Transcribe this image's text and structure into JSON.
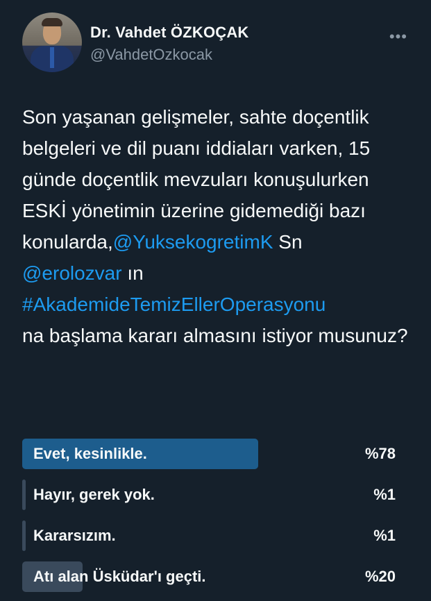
{
  "author": {
    "name": "Dr. Vahdet ÖZKOÇAK",
    "handle": "@VahdetOzkocak"
  },
  "tweet": {
    "text_1": "Son yaşanan gelişmeler, sahte doçentlik belgeleri ve dil puanı iddiaları varken, 15 günde doçentlik mevzuları konuşulurken ESKİ yönetimin üzerine gidemediği bazı konularda,",
    "mention_1": "@YuksekogretimK",
    "text_2": " Sn ",
    "mention_2": "@erolozvar",
    "text_3": " ın ",
    "hashtag": "#AkademideTemizEllerOperasyonu",
    "text_4": " na başlama kararı almasını istiyor musunuz?"
  },
  "poll": {
    "options": [
      {
        "label": "Evet, kesinlikle.",
        "percent_text": "%78",
        "percent": 78,
        "winner": true
      },
      {
        "label": "Hayır, gerek yok.",
        "percent_text": "%1",
        "percent": 1,
        "winner": false
      },
      {
        "label": "Kararsızım.",
        "percent_text": "%1",
        "percent": 1,
        "winner": false
      },
      {
        "label": "Atı alan Üsküdar'ı geçti.",
        "percent_text": "%20",
        "percent": 20,
        "winner": false
      }
    ]
  },
  "icons": {
    "more": "more-horizontal-icon"
  },
  "colors": {
    "background": "#15202b",
    "link": "#1d9bf0",
    "winner_bar": "#1d5d8d",
    "bar": "#3a4a5c"
  }
}
